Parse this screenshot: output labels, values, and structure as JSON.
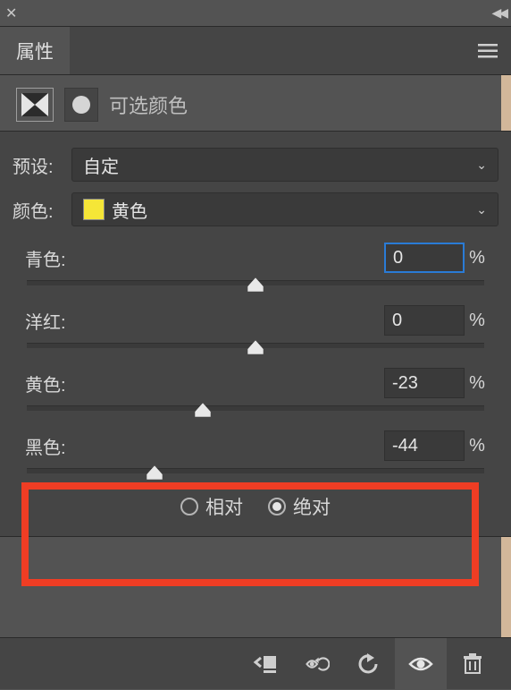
{
  "titlebar": {},
  "tab": {
    "label": "属性"
  },
  "header": {
    "title": "可选颜色"
  },
  "preset": {
    "label": "预设:",
    "value": "自定"
  },
  "color": {
    "label": "颜色:",
    "value": "黄色",
    "swatch": "#f5e637"
  },
  "sliders": {
    "cyan": {
      "label": "青色:",
      "value": "0",
      "thumb_pct": 50
    },
    "magenta": {
      "label": "洋红:",
      "value": "0",
      "thumb_pct": 50
    },
    "yellow": {
      "label": "黄色:",
      "value": "-23",
      "thumb_pct": 38.5
    },
    "black": {
      "label": "黑色:",
      "value": "-44",
      "thumb_pct": 28
    }
  },
  "method": {
    "relative": "相对",
    "absolute": "绝对",
    "selected": "absolute"
  },
  "pct_sign": "%"
}
